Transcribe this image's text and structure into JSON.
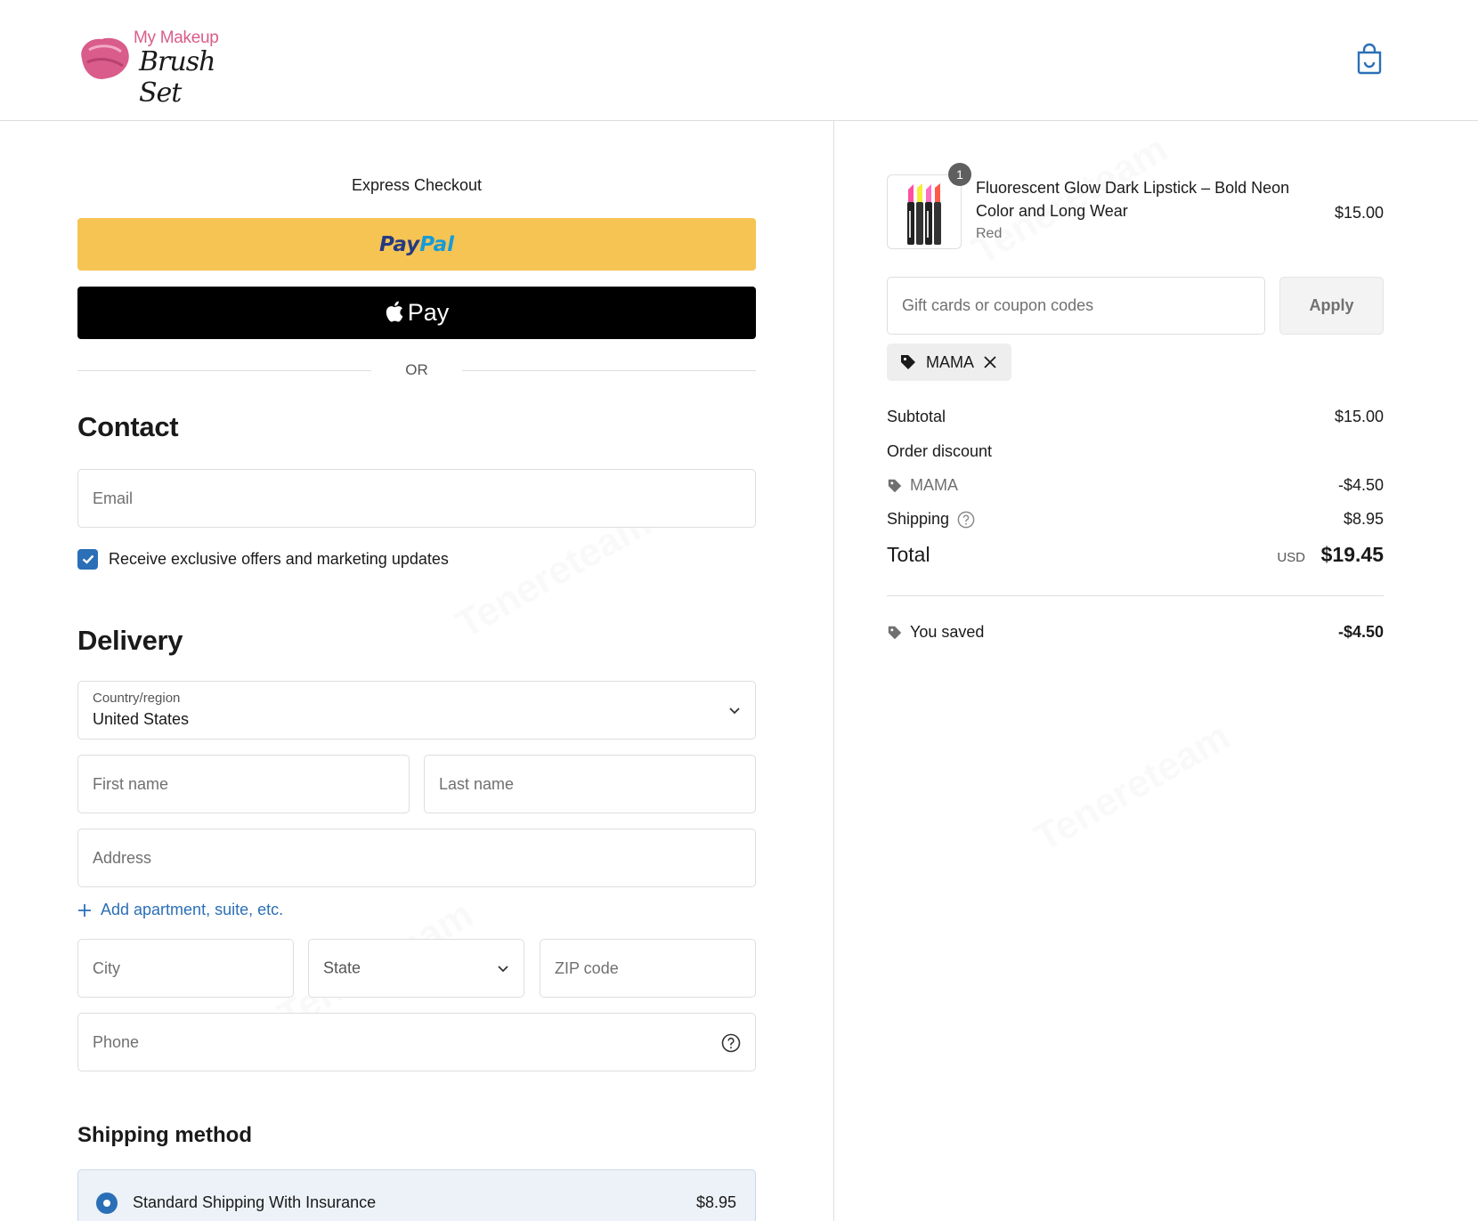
{
  "header": {
    "logo_small": "My Makeup",
    "logo_script": "Brush Set",
    "cart_icon": "shopping-bag-icon"
  },
  "express": {
    "title": "Express Checkout",
    "paypal_part1": "Pay",
    "paypal_part2": "Pal",
    "applepay_label": "Pay",
    "or_label": "OR"
  },
  "contact": {
    "heading": "Contact",
    "email_placeholder": "Email",
    "marketing_checked": true,
    "marketing_label": "Receive exclusive offers and marketing updates"
  },
  "delivery": {
    "heading": "Delivery",
    "country_label": "Country/region",
    "country_value": "United States",
    "first_name_placeholder": "First name",
    "last_name_placeholder": "Last name",
    "address_placeholder": "Address",
    "add_apartment_label": "Add apartment, suite, etc.",
    "city_placeholder": "City",
    "state_placeholder": "State",
    "zip_placeholder": "ZIP code",
    "phone_placeholder": "Phone"
  },
  "shipping_method": {
    "heading": "Shipping method",
    "option_name": "Standard Shipping With Insurance",
    "option_price": "$8.95"
  },
  "order": {
    "product": {
      "quantity": "1",
      "name": "Fluorescent Glow Dark Lipstick – Bold Neon Color and Long Wear",
      "variant": "Red",
      "price": "$15.00"
    },
    "coupon_placeholder": "Gift cards or coupon codes",
    "apply_label": "Apply",
    "applied_code": "MAMA",
    "subtotal_label": "Subtotal",
    "subtotal_value": "$15.00",
    "discount_label": "Order discount",
    "discount_code": "MAMA",
    "discount_value": "-$4.50",
    "shipping_label": "Shipping",
    "shipping_value": "$8.95",
    "total_label": "Total",
    "total_currency": "USD",
    "total_value": "$19.45",
    "saved_label": "You saved",
    "saved_value": "-$4.50"
  },
  "colors": {
    "paypal_yellow": "#f6c453",
    "accent_blue": "#2b6fb6",
    "logo_pink": "#d95c8a"
  }
}
